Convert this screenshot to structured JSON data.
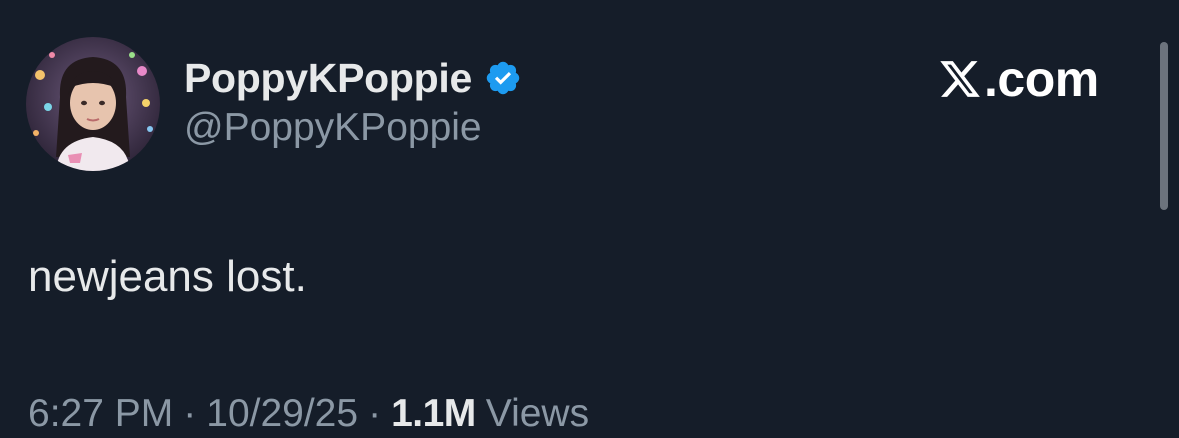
{
  "author": {
    "display_name": "PoppyKPoppie",
    "handle": "@PoppyKPoppie",
    "verified": true,
    "avatar": "profile-photo"
  },
  "brand": {
    "logo": "x-logo-icon",
    "domain": ".com"
  },
  "tweet": {
    "text": "newjeans lost."
  },
  "meta": {
    "time": "6:27 PM",
    "separator": "·",
    "date": "10/29/25",
    "views_count": "1.1M",
    "views_label": "Views"
  },
  "colors": {
    "background": "#151d29",
    "primary_text": "#e7e9ea",
    "secondary_text": "#8b98a5",
    "verified_badge": "#1d9bf0"
  }
}
